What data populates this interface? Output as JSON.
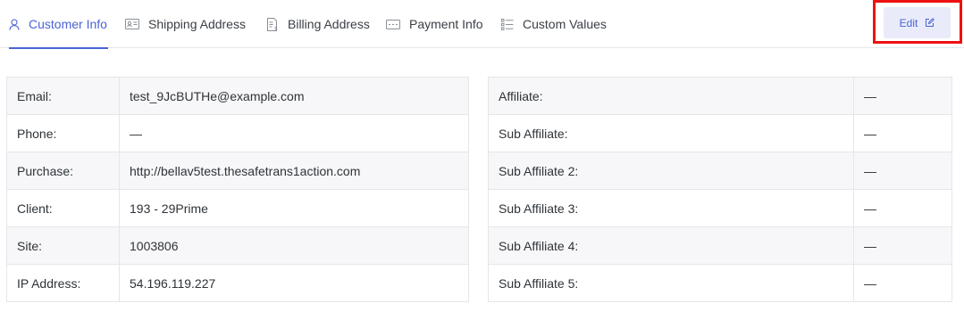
{
  "tabs": [
    {
      "label": "Customer Info",
      "icon": "user-icon",
      "active": true
    },
    {
      "label": "Shipping Address",
      "icon": "address-card-icon",
      "active": false
    },
    {
      "label": "Billing Address",
      "icon": "invoice-icon",
      "active": false
    },
    {
      "label": "Payment Info",
      "icon": "credit-card-icon",
      "active": false
    },
    {
      "label": "Custom Values",
      "icon": "list-icon",
      "active": false
    }
  ],
  "edit_button": {
    "label": "Edit",
    "icon": "edit-icon"
  },
  "customer_table": [
    {
      "label": "Email:",
      "value": "test_9JcBUTHe@example.com"
    },
    {
      "label": "Phone:",
      "value": "—"
    },
    {
      "label": "Purchase:",
      "value": "http://bellav5test.thesafetrans1action.com"
    },
    {
      "label": "Client:",
      "value": "193 - 29Prime"
    },
    {
      "label": "Site:",
      "value": "1003806"
    },
    {
      "label": "IP Address:",
      "value": "54.196.119.227"
    }
  ],
  "affiliate_table": [
    {
      "label": "Affiliate:",
      "value": "—"
    },
    {
      "label": "Sub Affiliate:",
      "value": "—"
    },
    {
      "label": "Sub Affiliate 2:",
      "value": "—"
    },
    {
      "label": "Sub Affiliate 3:",
      "value": "—"
    },
    {
      "label": "Sub Affiliate 4:",
      "value": "—"
    },
    {
      "label": "Sub Affiliate 5:",
      "value": "—"
    }
  ],
  "colors": {
    "accent": "#4a63d6",
    "highlight_border": "#ee1111",
    "edit_button_bg": "#e9ebfa"
  }
}
